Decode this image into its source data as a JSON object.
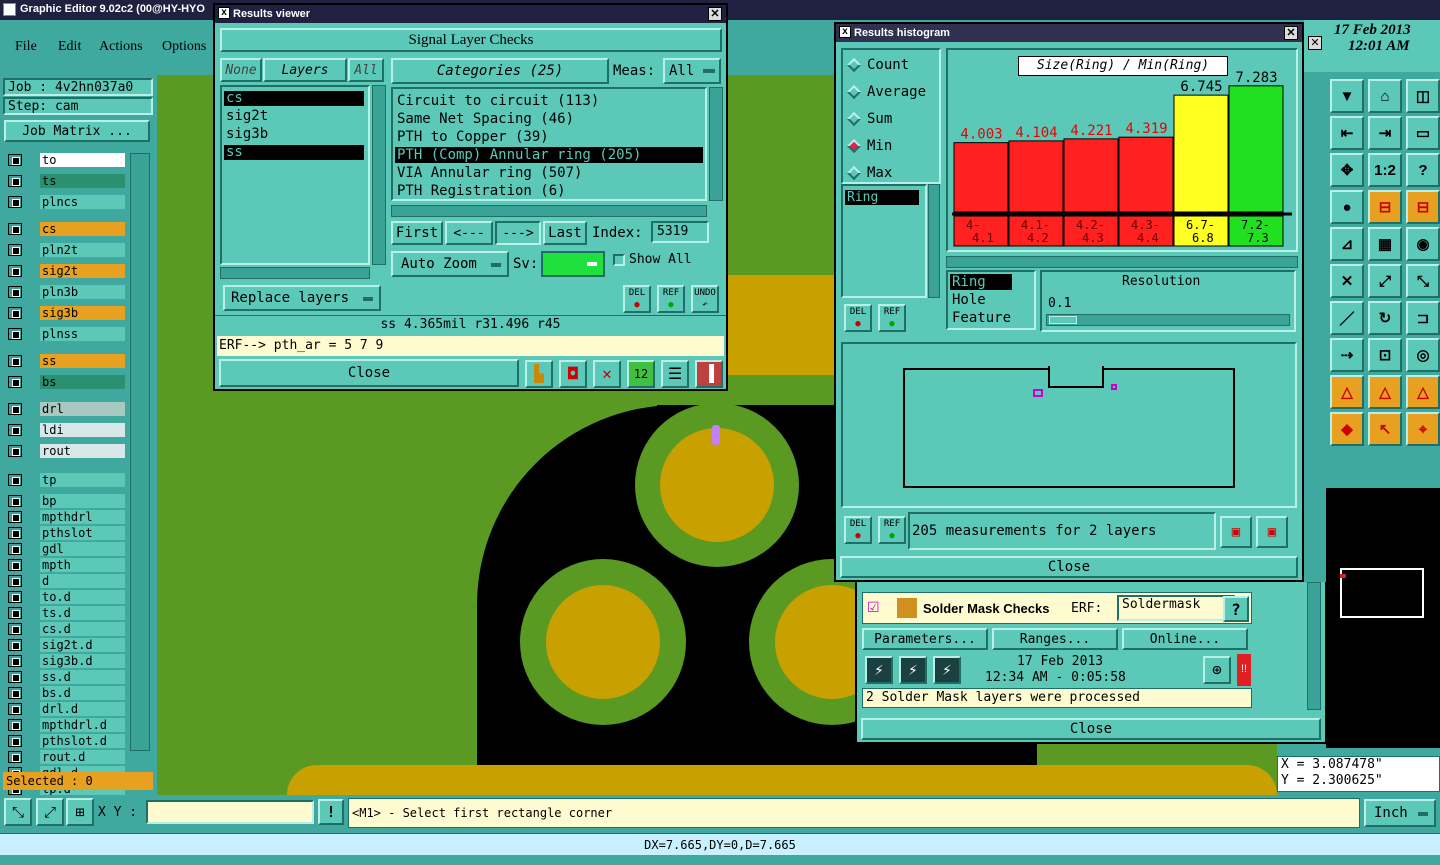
{
  "app": {
    "title": "Graphic Editor 9.02c2 (00@HY-HYO"
  },
  "menu": [
    "File",
    "Edit",
    "Actions",
    "Options"
  ],
  "job": {
    "job": "Job : 4v2hn037a0",
    "step": "Step: cam",
    "matrix": "Job Matrix ..."
  },
  "layers": [
    "to",
    "ts",
    "plncs",
    "cs",
    "pln2t",
    "sig2t",
    "pln3b",
    "sig3b",
    "plnss",
    "ss",
    "bs",
    "drl",
    "ldi",
    "rout",
    "tp",
    "bp",
    "mpthdrl",
    "pthslot",
    "gdl",
    "mpth",
    "d",
    "to.d",
    "ts.d",
    "cs.d",
    "sig2t.d",
    "sig3b.d",
    "ss.d",
    "bs.d",
    "drl.d",
    "mpthdrl.d",
    "pthslot.d",
    "rout.d",
    "gdl.d",
    "tp.d"
  ],
  "selected": "Selected : 0",
  "datetime": {
    "date": "17 Feb 2013",
    "time": "12:01 AM"
  },
  "results_viewer": {
    "title": "Results viewer",
    "header": "Signal Layer Checks",
    "none": "None",
    "layers_label": "Layers",
    "all": "All",
    "categories_label": "Categories (25)",
    "meas_label": "Meas:",
    "meas_value": "All",
    "layer_items": [
      "cs",
      "sig2t",
      "sig3b",
      "ss"
    ],
    "categories": [
      "Circuit to circuit (113)",
      "Same Net Spacing (46)",
      "PTH to Copper (39)",
      "PTH (Comp) Annular ring (205)",
      "VIA Annular ring (507)",
      "PTH Registration (6)"
    ],
    "first": "First",
    "prev": "<---",
    "next": "--->",
    "last": "Last",
    "index_label": "Index:",
    "index_value": "5319",
    "auto_zoom": "Auto Zoom",
    "sv_label": "Sv:",
    "show_all": "Show All",
    "replace_layers": "Replace layers",
    "del": "DEL",
    "ref": "REF",
    "undo": "UNDO",
    "status": "ss 4.365mil  r31.496  r45",
    "erf": "ERF--> pth_ar = 5 7 9",
    "close": "Close"
  },
  "histogram": {
    "title": "Results histogram",
    "modes": [
      "Count",
      "Average",
      "Sum",
      "Min",
      "Max"
    ],
    "chart_title": "Size(Ring) / Min(Ring)",
    "ring_item": "Ring",
    "types": [
      "Ring",
      "Hole",
      "Feature"
    ],
    "resolution_label": "Resolution",
    "resolution_value": "0.1",
    "measurements": "205 measurements for 2 layers",
    "del": "DEL",
    "ref": "REF",
    "close": "Close"
  },
  "chart_data": {
    "type": "bar",
    "title": "Size(Ring) / Min(Ring)",
    "categories": [
      "4-4.1",
      "4.1-4.2",
      "4.2-4.3",
      "4.3-4.4",
      "6.7-6.8",
      "7.2-7.3"
    ],
    "values": [
      4.003,
      4.104,
      4.221,
      4.319,
      6.745,
      7.283
    ],
    "labels": [
      "4.003",
      "4.104",
      "4.221",
      "4.319",
      "6.745",
      "7.283"
    ],
    "tick_labels": [
      [
        "4-",
        "4.1"
      ],
      [
        "4.1-",
        "4.2"
      ],
      [
        "4.2-",
        "4.3"
      ],
      [
        "4.3-",
        "4.4"
      ],
      [
        "6.7-",
        "6.8"
      ],
      [
        "7.2-",
        "7.3"
      ]
    ],
    "colors": [
      "#ff2020",
      "#ff2020",
      "#ff2020",
      "#ff2020",
      "#ffff20",
      "#20e020"
    ],
    "ylim": [
      0,
      8
    ]
  },
  "solder": {
    "title": "Solder Mask Checks",
    "erf_label": "ERF:",
    "erf_value": "Soldermask",
    "help": "?",
    "parameters": "Parameters...",
    "ranges": "Ranges...",
    "online": "Online...",
    "date": "17 Feb 2013",
    "time": "12:34 AM - 0:05:58",
    "message": "2 Solder Mask layers were processed",
    "close": "Close"
  },
  "coords": {
    "x": "X = 3.087478\"",
    "y": "Y = 2.300625\""
  },
  "bottom": {
    "xy_label": "X Y :",
    "prompt": "<M1> - Select first rectangle corner",
    "unit": "Inch",
    "status": "DX=7.665,DY=0,D=7.665"
  }
}
